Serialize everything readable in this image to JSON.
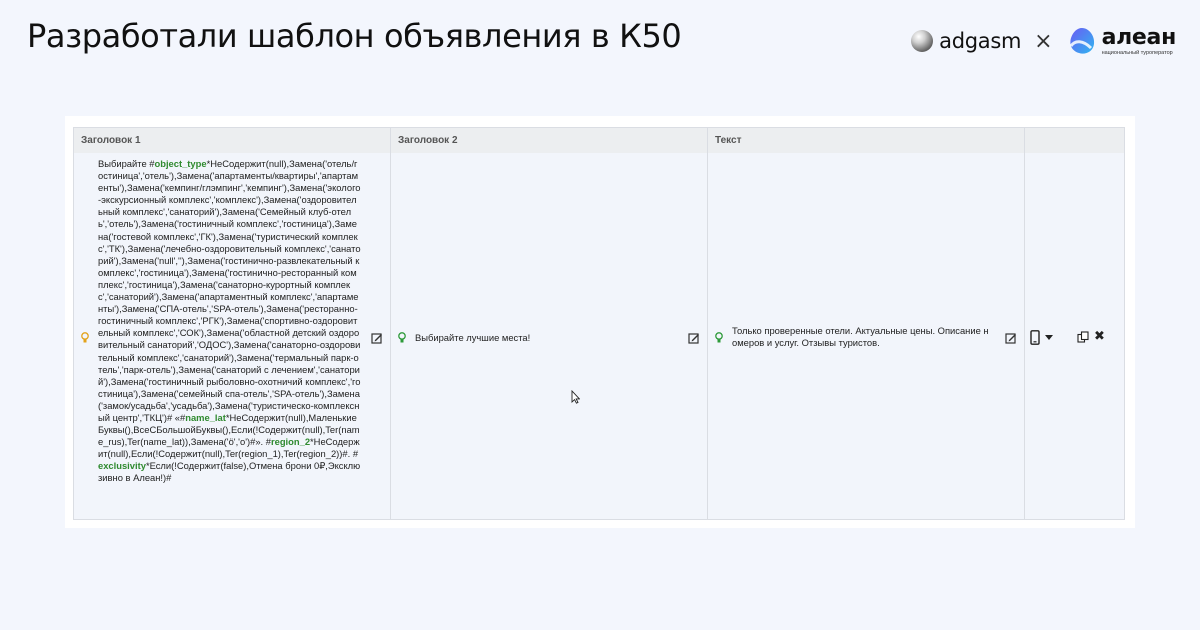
{
  "page": {
    "title": "Разработали шаблон объявления в К50"
  },
  "brands": {
    "left_name": "adgasm",
    "separator": "×",
    "right_name": "алеан",
    "right_tagline": "национальный туроператор"
  },
  "table": {
    "columns": [
      "Заголовок 1",
      "Заголовок 2",
      "Текст",
      ""
    ],
    "row": {
      "headline1_parts": [
        {
          "text": "Выбирайте #",
          "hl": false
        },
        {
          "text": "object_type",
          "hl": true
        },
        {
          "text": "*НеСодержит(null),Замена('отель/гостиница','отель'),Замена('апартаменты/квартиры','апартаменты'),Замена('кемпинг/глэмпинг','кемпинг'),Замена('эколого-экскурсионный комплекс','комплекс'),Замена('оздоровительный комплекс','санаторий'),Замена('Семейный клуб-отель','отель'),Замена('гостиничный комплекс','гостиница'),Замена('гостевой комплекс','ГК'),Замена('туристический комплекс','ТК'),Замена('лечебно-оздоровительный комплекс','санаторий'),Замена('null',''),Замена('гостинично-развлекательный комплекс','гостиница'),Замена('гостинично-ресторанный комплекс','гостиница'),Замена('санаторно-курортный комплекс','санаторий'),Замена('апартаментный комплекс','апартаменты'),Замена('СПА-отель','SPA-отель'),Замена('ресторанно-гостиничный комплекс','РГК'),Замена('спортивно-оздоровительный комплекс','СОК'),Замена('областной детский оздоровительный санаторий','ОДОС'),Замена('санаторно-оздоровительный комплекс','санаторий'),Замена('термальный парк-отель','парк-отель'),Замена('санаторий с лечением','санаторий'),Замена('гостиничный рыболовно-охотничий комплекс','гостиница'),Замена('семейный спа-отель','SPA-отель'),Замена('замок/усадьба','усадьба'),Замена('туристическо-комплексный центр','ТКЦ')# «#",
          "hl": false
        },
        {
          "text": "name_lat",
          "hl": true
        },
        {
          "text": "*НеСодержит(null),МаленькиеБуквы(),ВсеСБольшойБуквы(),Если(!Содержит(null),Ter(name_rus),Ter(name_lat)),Замена('ö','o')#». #",
          "hl": false
        },
        {
          "text": "region_2",
          "hl": true
        },
        {
          "text": "*НеСодержит(null),Если(!Содержит(null),Ter(region_1),Ter(region_2))#. #",
          "hl": false
        },
        {
          "text": "exclusivity",
          "hl": true
        },
        {
          "text": "*Если(!Содержит(false),Отмена брони 0₽,Эксклюзивно в Алеан!)#",
          "hl": false
        }
      ],
      "headline2": "Выбирайте лучшие места!",
      "text": "Только проверенные отели. Актуальные цены. Описание номеров и услуг. Отзывы туристов."
    }
  },
  "icons": {
    "bulb_warning_color": "#e3a21a",
    "bulb_ok_color": "#2e9a3a",
    "highlight_color": "#2f8a2f"
  }
}
